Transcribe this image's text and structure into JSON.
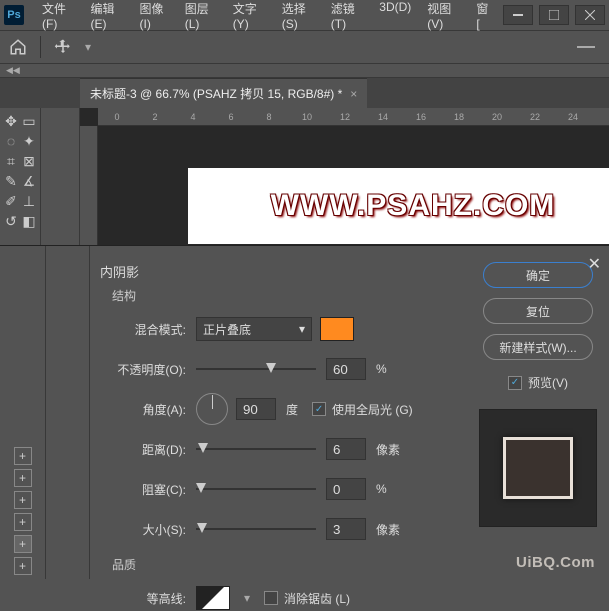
{
  "menus": [
    "文件(F)",
    "编辑(E)",
    "图像(I)",
    "图层(L)",
    "文字(Y)",
    "选择(S)",
    "滤镜(T)",
    "3D(D)",
    "视图(V)",
    "窗["
  ],
  "doc_tab": {
    "title": "未标题-3 @ 66.7% (PSAHZ 拷贝 15, RGB/8#) *"
  },
  "ruler": [
    "0",
    "2",
    "4",
    "6",
    "8",
    "10",
    "12",
    "14",
    "16",
    "18",
    "20",
    "22",
    "24"
  ],
  "canvas_text": "WWW.PSAHZ.COM",
  "dialog": {
    "title": "内阴影",
    "structure": "结构",
    "blend_mode_label": "混合模式:",
    "blend_mode_value": "正片叠底",
    "swatch_color": "#ff8a1f",
    "opacity_label": "不透明度(O):",
    "opacity_value": "60",
    "opacity_unit": "%",
    "angle_label": "角度(A):",
    "angle_value": "90",
    "angle_unit": "度",
    "global_light_label": "使用全局光 (G)",
    "distance_label": "距离(D):",
    "distance_value": "6",
    "distance_unit": "像素",
    "spread_label": "阻塞(C):",
    "spread_value": "0",
    "spread_unit": "%",
    "size_label": "大小(S):",
    "size_value": "3",
    "size_unit": "像素",
    "quality": "品质",
    "contour_label": "等高线:",
    "antialias_label": "消除锯齿 (L)",
    "ok": "确定",
    "reset": "复位",
    "new_style": "新建样式(W)...",
    "preview": "预览(V)"
  },
  "watermark": "UiBQ.Com"
}
